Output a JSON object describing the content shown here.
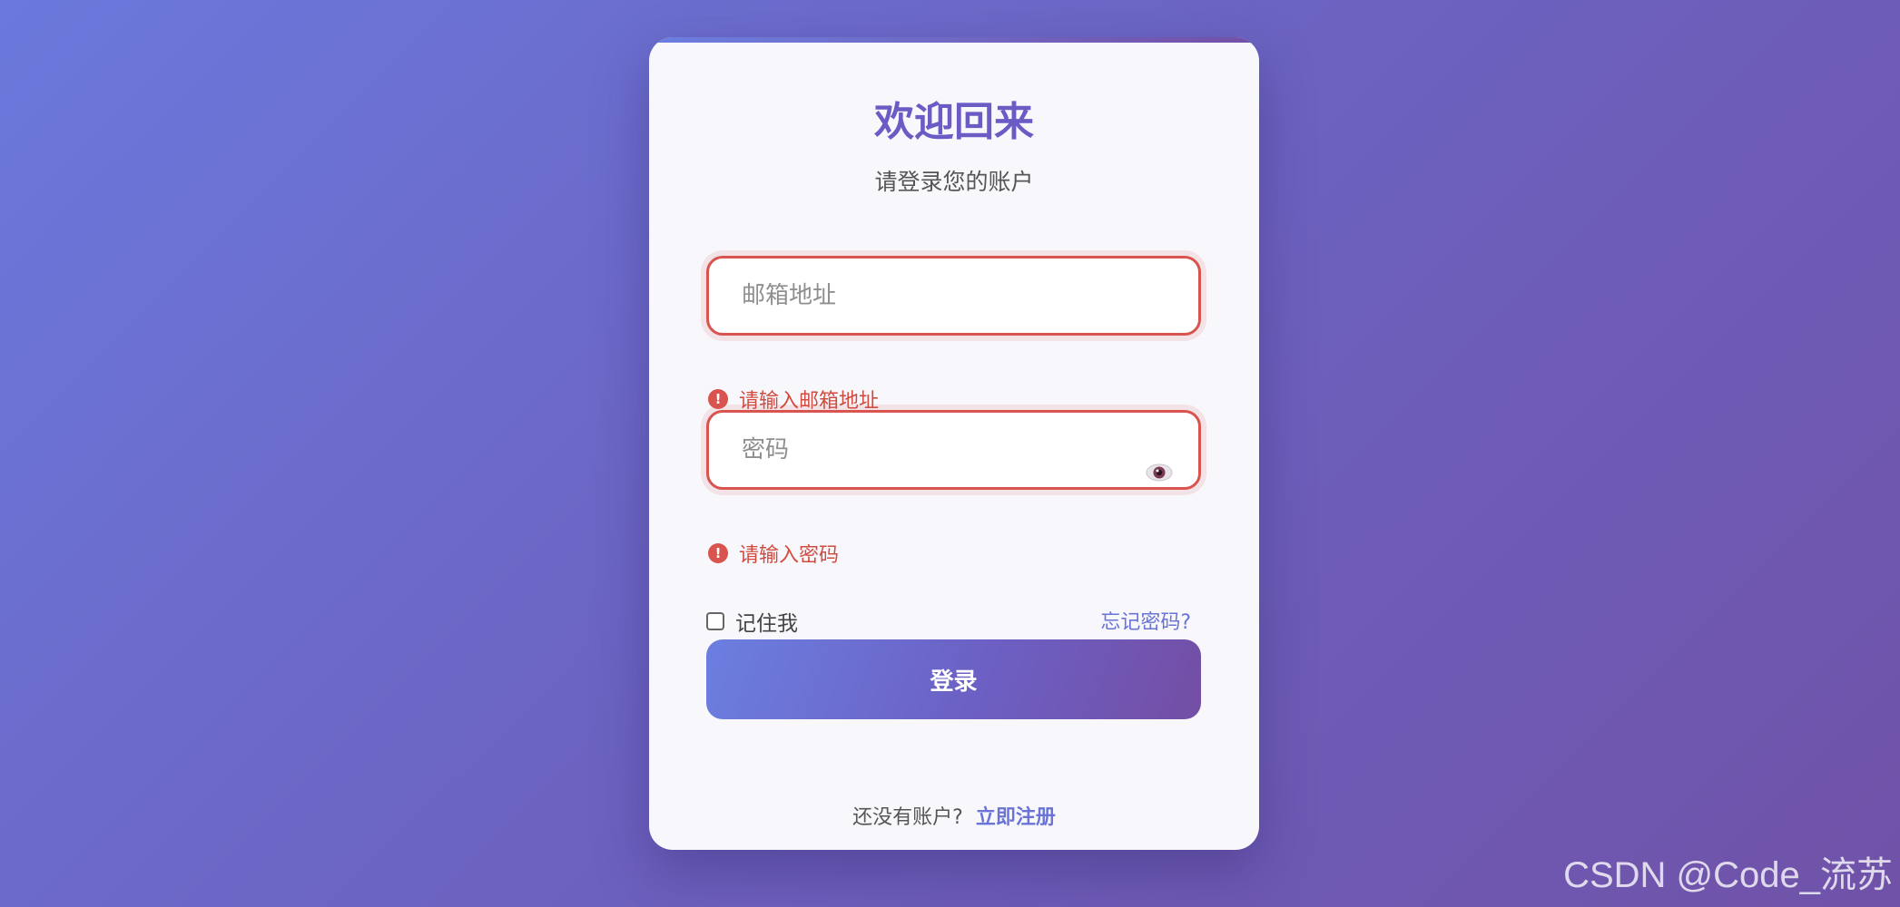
{
  "login": {
    "title": "欢迎回来",
    "subtitle": "请登录您的账户",
    "email": {
      "placeholder": "邮箱地址",
      "value": "",
      "error": "请输入邮箱地址"
    },
    "password": {
      "placeholder": "密码",
      "value": "",
      "error": "请输入密码",
      "toggle_icon": "eye-icon"
    },
    "remember_label": "记住我",
    "remember_checked": false,
    "forgot_label": "忘记密码?",
    "submit_label": "登录",
    "signup_prompt": "还没有账户?",
    "signup_label": "立即注册"
  },
  "watermark": "CSDN @Code_流苏",
  "colors": {
    "accent": "#6a5cc4",
    "link": "#6a74d6",
    "error": "#d9534f",
    "background_start": "#6b79dc",
    "background_end": "#7052a8"
  },
  "icons": {
    "error": "alert-circle-icon",
    "password_toggle": "eye-icon",
    "checkbox": "checkbox-icon"
  }
}
